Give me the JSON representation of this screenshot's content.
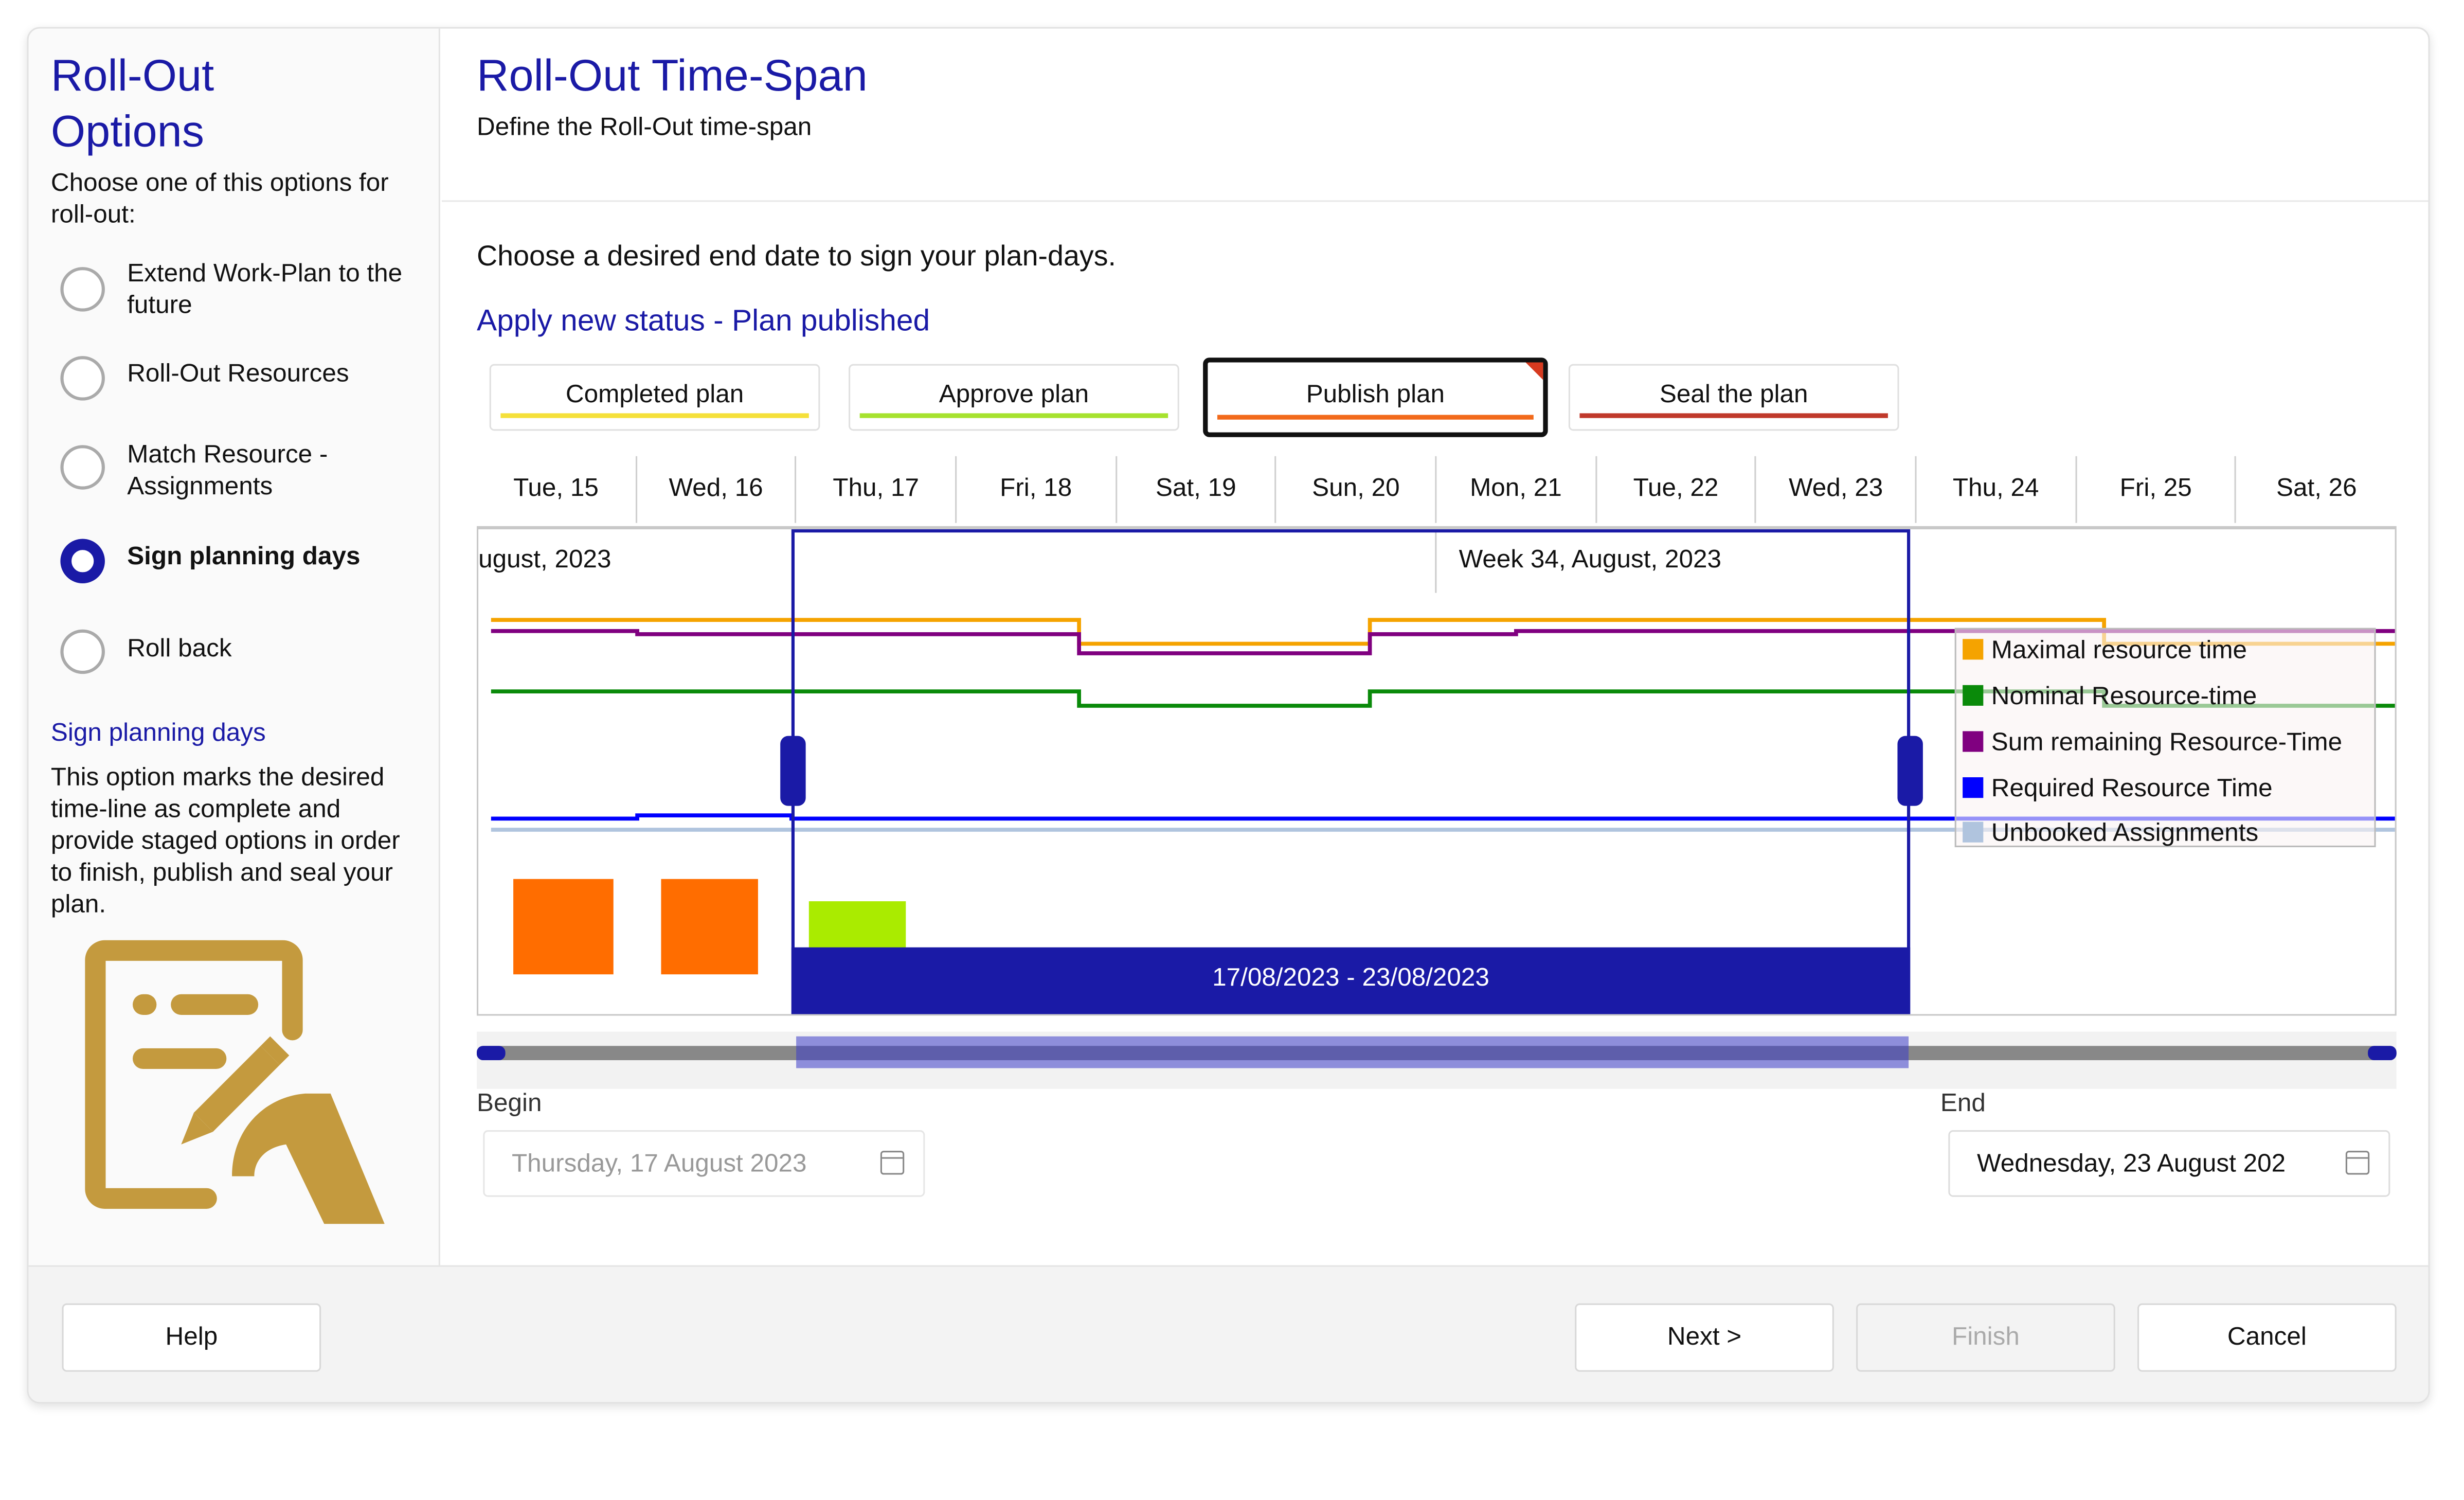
{
  "sidebar": {
    "title_line1": "Roll-Out",
    "title_line2": "Options",
    "intro": "Choose one of this options for roll-out:",
    "options": [
      {
        "label": "Extend Work-Plan to the future"
      },
      {
        "label": "Roll-Out Resources"
      },
      {
        "label": "Match Resource - Assignments"
      },
      {
        "label": "Sign planning days",
        "selected": true
      },
      {
        "label": "Roll back"
      }
    ],
    "help_title": "Sign planning days",
    "help_text": "This option marks the desired time-line as complete and provide staged options in order to finish, publish and seal your plan.",
    "logo_icon": "document-sign-icon",
    "logo_color": "#c49a3e"
  },
  "main": {
    "title": "Roll-Out Time-Span",
    "subtitle": "Define the Roll-Out time-span",
    "prompt": "Choose a desired end date to sign your plan-days.",
    "status_link": "Apply new status - Plan published",
    "stages": [
      {
        "label": "Completed plan",
        "color": "#f5e03a"
      },
      {
        "label": "Approve plan",
        "color": "#a6e22e"
      },
      {
        "label": "Publish plan",
        "color": "#f26a1b",
        "active": true
      },
      {
        "label": "Seal the plan",
        "color": "#c0392b"
      }
    ]
  },
  "timeline": {
    "days": [
      "Tue, 15",
      "Wed, 16",
      "Thu, 17",
      "Fri, 18",
      "Sat, 19",
      "Sun, 20",
      "Mon, 21",
      "Tue, 22",
      "Wed, 23",
      "Thu, 24",
      "Fri, 25",
      "Sat, 26"
    ],
    "week_left": "ugust, 2023",
    "week_right": "Week 34, August, 2023",
    "range_label": "17/08/2023 - 23/08/2023",
    "legend": [
      {
        "label": "Maximal resource time",
        "color": "#f5a300"
      },
      {
        "label": "Nominal Resource-time",
        "color": "#0a8a0a"
      },
      {
        "label": "Sum remaining Resource-Time",
        "color": "#800080"
      },
      {
        "label": "Required Resource Time",
        "color": "#0000ff"
      },
      {
        "label": "Unbooked Assignments",
        "color": "#b0c4de"
      }
    ],
    "accent": "#1a1aa6"
  },
  "dates": {
    "begin_label": "Begin",
    "begin_value": "Thursday, 17 August 2023",
    "end_label": "End",
    "end_value": "Wednesday, 23 August 202"
  },
  "footer": {
    "help": "Help",
    "next": "Next >",
    "finish": "Finish",
    "cancel": "Cancel"
  }
}
